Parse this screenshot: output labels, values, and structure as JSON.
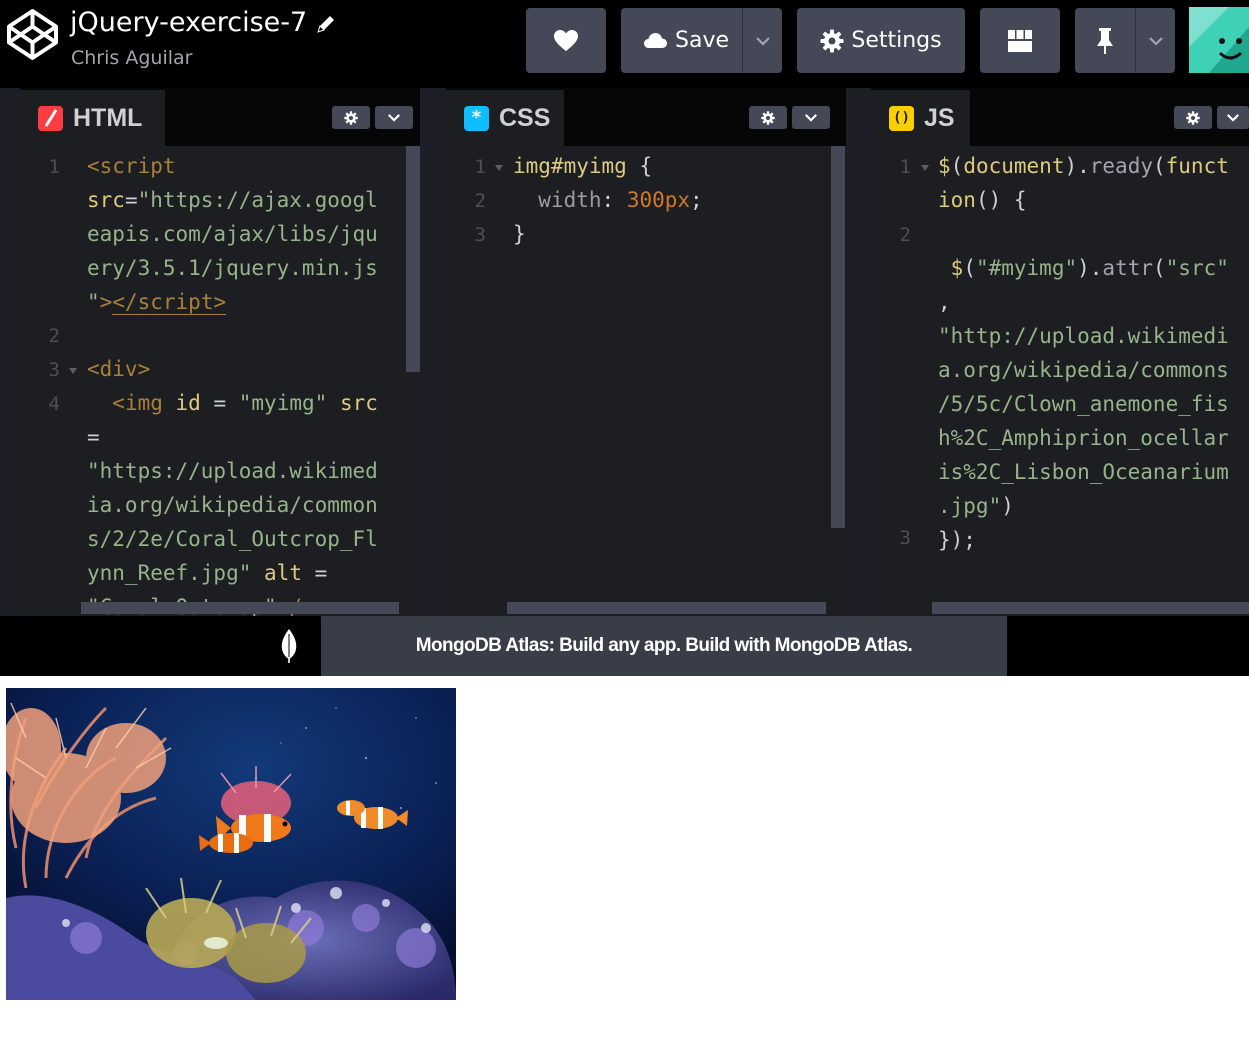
{
  "header": {
    "title": "jQuery-exercise-7",
    "author": "Chris Aguilar",
    "buttons": {
      "save_label": "Save",
      "settings_label": "Settings"
    }
  },
  "panels": {
    "html": {
      "label": "HTML",
      "icon": "html-icon",
      "accent": "#ff3c41",
      "line_numbers": [
        "1",
        "2",
        "3",
        "4"
      ]
    },
    "css": {
      "label": "CSS",
      "icon": "css-icon",
      "accent": "#0ebeff",
      "line_numbers": [
        "1",
        "2",
        "3"
      ]
    },
    "js": {
      "label": "JS",
      "icon": "js-icon",
      "accent": "#fcd000",
      "line_numbers": [
        "1",
        "2",
        "3"
      ]
    }
  },
  "ad": {
    "text": "MongoDB Atlas: Build any app. Build with MongoDB Atlas.",
    "close": "✕"
  },
  "preview": {
    "image": "clownfish-anemone-photo"
  }
}
